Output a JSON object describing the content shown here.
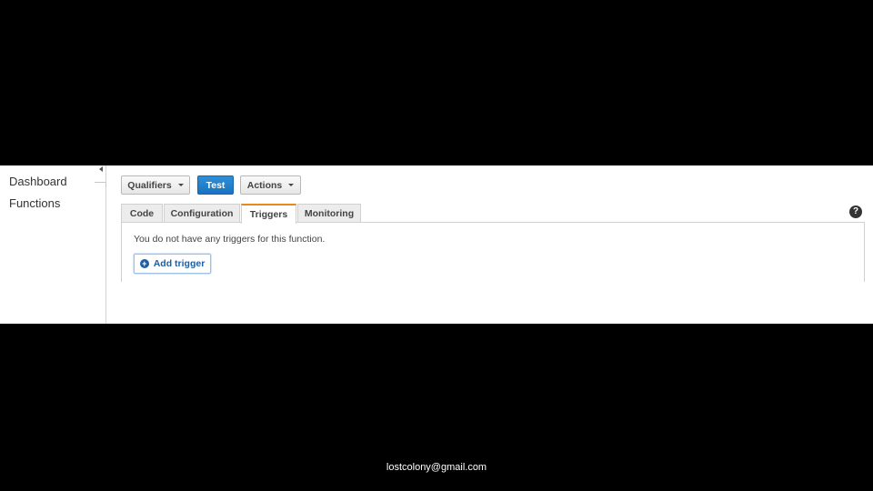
{
  "sidebar": {
    "items": [
      {
        "label": "Dashboard"
      },
      {
        "label": "Functions"
      }
    ]
  },
  "toolbar": {
    "qualifiers_label": "Qualifiers",
    "test_label": "Test",
    "actions_label": "Actions"
  },
  "tabs": [
    {
      "label": "Code"
    },
    {
      "label": "Configuration"
    },
    {
      "label": "Triggers",
      "active": true
    },
    {
      "label": "Monitoring"
    }
  ],
  "help_icon": "?",
  "panel": {
    "message": "You do not have any triggers for this function.",
    "add_trigger_label": "Add trigger",
    "add_icon": "+"
  },
  "footer": {
    "email": "lostcolony@gmail.com"
  },
  "colors": {
    "primary_button": "#1a73c0",
    "active_tab_accent": "#e88a1a"
  }
}
